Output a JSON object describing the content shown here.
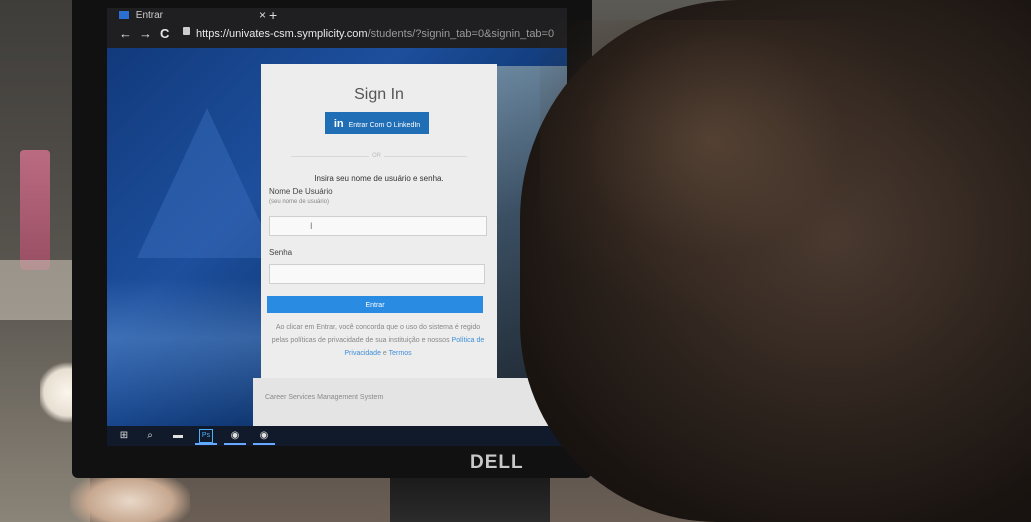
{
  "browser": {
    "tab_title": "Entrar",
    "tab_close": "×",
    "tab_new": "+",
    "nav_back": "←",
    "nav_forward": "→",
    "nav_reload": "C",
    "url_host": "https://univates-csm.symplicity.com",
    "url_path": "/students/?signin_tab=0&signin_tab=0"
  },
  "login": {
    "title": "Sign In",
    "linkedin_icon": "in",
    "linkedin_label": "Entrar Com O LinkedIn",
    "or_label": "OR",
    "instruction": "Insira seu nome de usuário e senha.",
    "username_label": "Nome De Usuário",
    "username_hint": "(seu nome de usuário)",
    "username_value": "I",
    "password_label": "Senha",
    "submit_label": "Entrar",
    "terms_text": "Ao clicar em Entrar, você concorda que o uso do sistema é regido pelas políticas de privacidade de sua instituição e nossos",
    "privacy_link": "Política de Privacidade",
    "terms_and": "e",
    "terms_link": "Termos"
  },
  "footer": {
    "system_name": "Career Services Management System"
  },
  "taskbar": {
    "items": [
      "windows-start",
      "search",
      "file-explorer",
      "photoshop",
      "chrome",
      "chrome"
    ],
    "photoshop_label": "Ps"
  },
  "monitor": {
    "brand": "DELL"
  },
  "colors": {
    "linkedin_blue": "#1f6eb6",
    "submit_blue": "#2a8be3",
    "link_blue": "#3f8fd9",
    "wallpaper_blue": "#123a7c"
  }
}
